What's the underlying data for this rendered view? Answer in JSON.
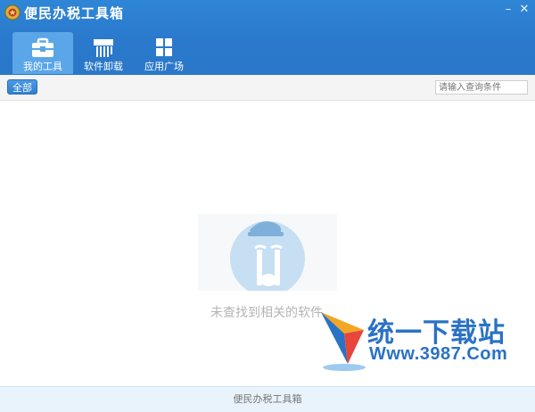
{
  "window": {
    "title": "便民办税工具箱",
    "minimize": "–",
    "close": "✕"
  },
  "tabs": [
    {
      "label": "我的工具",
      "icon": "toolbox-icon",
      "active": true
    },
    {
      "label": "软件卸载",
      "icon": "uninstall-icon",
      "active": false
    },
    {
      "label": "应用广场",
      "icon": "grid-apps-icon",
      "active": false
    }
  ],
  "toolbar": {
    "all_label": "全部",
    "search_placeholder": "请输入查询条件"
  },
  "main": {
    "empty_message": "未查找到相关的软件"
  },
  "watermark": {
    "brand": "统一下载站",
    "url": "Www.3987.Com"
  },
  "footer": {
    "text": "便民办税工具箱"
  },
  "colors": {
    "header": "#2b7ccf",
    "active_tab": "#5aa6e8",
    "footer_bg": "#e8f3fb",
    "watermark": "#2a72c4"
  }
}
